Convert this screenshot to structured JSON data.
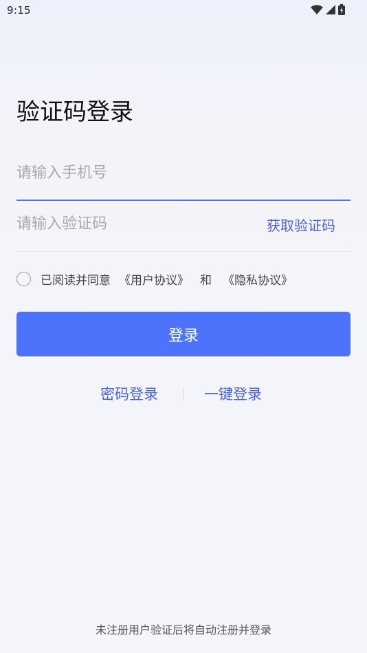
{
  "status_bar": {
    "time": "9:15",
    "icons": [
      "wifi-icon",
      "cell-signal-icon",
      "battery-charging-icon"
    ]
  },
  "title": "验证码登录",
  "phone_field": {
    "value": "",
    "placeholder": "请输入手机号"
  },
  "code_field": {
    "value": "",
    "placeholder": "请输入验证码",
    "get_code_label": "获取验证码"
  },
  "agreement": {
    "checked": false,
    "prefix": "已阅读并同意",
    "user_agreement": "《用户协议》",
    "and": "和",
    "privacy_policy": "《隐私协议》"
  },
  "login_button": "登录",
  "alt_login": {
    "password_login": "密码登录",
    "one_key_login": "一键登录"
  },
  "footer_note": "未注册用户验证后将自动注册并登录",
  "colors": {
    "accent": "#4d73fc",
    "link": "#4a63dd",
    "placeholder": "#a7a9b0"
  }
}
